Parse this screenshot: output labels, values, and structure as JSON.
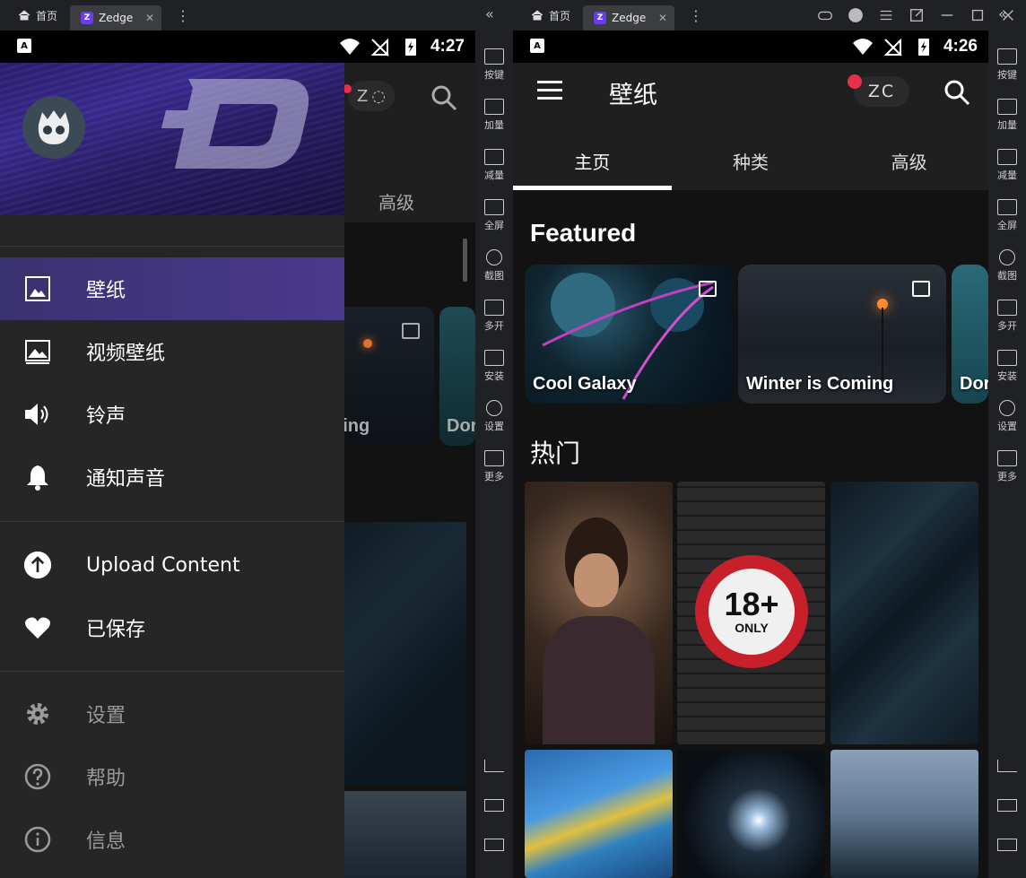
{
  "left": {
    "titlebar": {
      "home_label": "首页",
      "app_tab_label": "Zedge",
      "app_tab_icon": "Z"
    },
    "status": {
      "time": "4:27",
      "notif": "A"
    },
    "background_peek": {
      "tab_label": "高级",
      "zc": "Z",
      "feat_partial_1": "ning",
      "feat_partial_2": "Dor"
    },
    "drawer": {
      "items_top": [
        {
          "label": "壁纸",
          "icon": "wallpaper-icon",
          "selected": true
        },
        {
          "label": "视频壁纸",
          "icon": "video-wallpaper-icon"
        },
        {
          "label": "铃声",
          "icon": "speaker-icon"
        },
        {
          "label": "通知声音",
          "icon": "bell-icon"
        }
      ],
      "items_mid": [
        {
          "label": "Upload Content",
          "icon": "upload-icon"
        },
        {
          "label": "已保存",
          "icon": "heart-icon"
        }
      ],
      "items_bottom": [
        {
          "label": "设置",
          "icon": "gear-icon"
        },
        {
          "label": "帮助",
          "icon": "help-icon"
        },
        {
          "label": "信息",
          "icon": "info-icon"
        }
      ]
    }
  },
  "right": {
    "titlebar": {
      "home_label": "首页",
      "app_tab_label": "Zedge",
      "app_tab_icon": "Z"
    },
    "status": {
      "time": "4:26",
      "notif": "A"
    },
    "appbar": {
      "title": "壁纸",
      "zc_label": "ZC"
    },
    "tabs": [
      "主页",
      "种类",
      "高级"
    ],
    "featured_title": "Featured",
    "featured": [
      {
        "label": "Cool Galaxy"
      },
      {
        "label": "Winter is Coming"
      },
      {
        "label": "Dor"
      }
    ],
    "popular_title": "热门",
    "thumb_18": {
      "big": "18+",
      "small": "ONLY"
    }
  },
  "sidepanel": {
    "items": [
      "按键",
      "加量",
      "减量",
      "全屏",
      "截图",
      "多开",
      "安装",
      "设置",
      "更多"
    ]
  },
  "colors": {
    "accent": "#6a3de8",
    "badge": "#e8304a",
    "drawer_selected": "#4a3a8c"
  }
}
